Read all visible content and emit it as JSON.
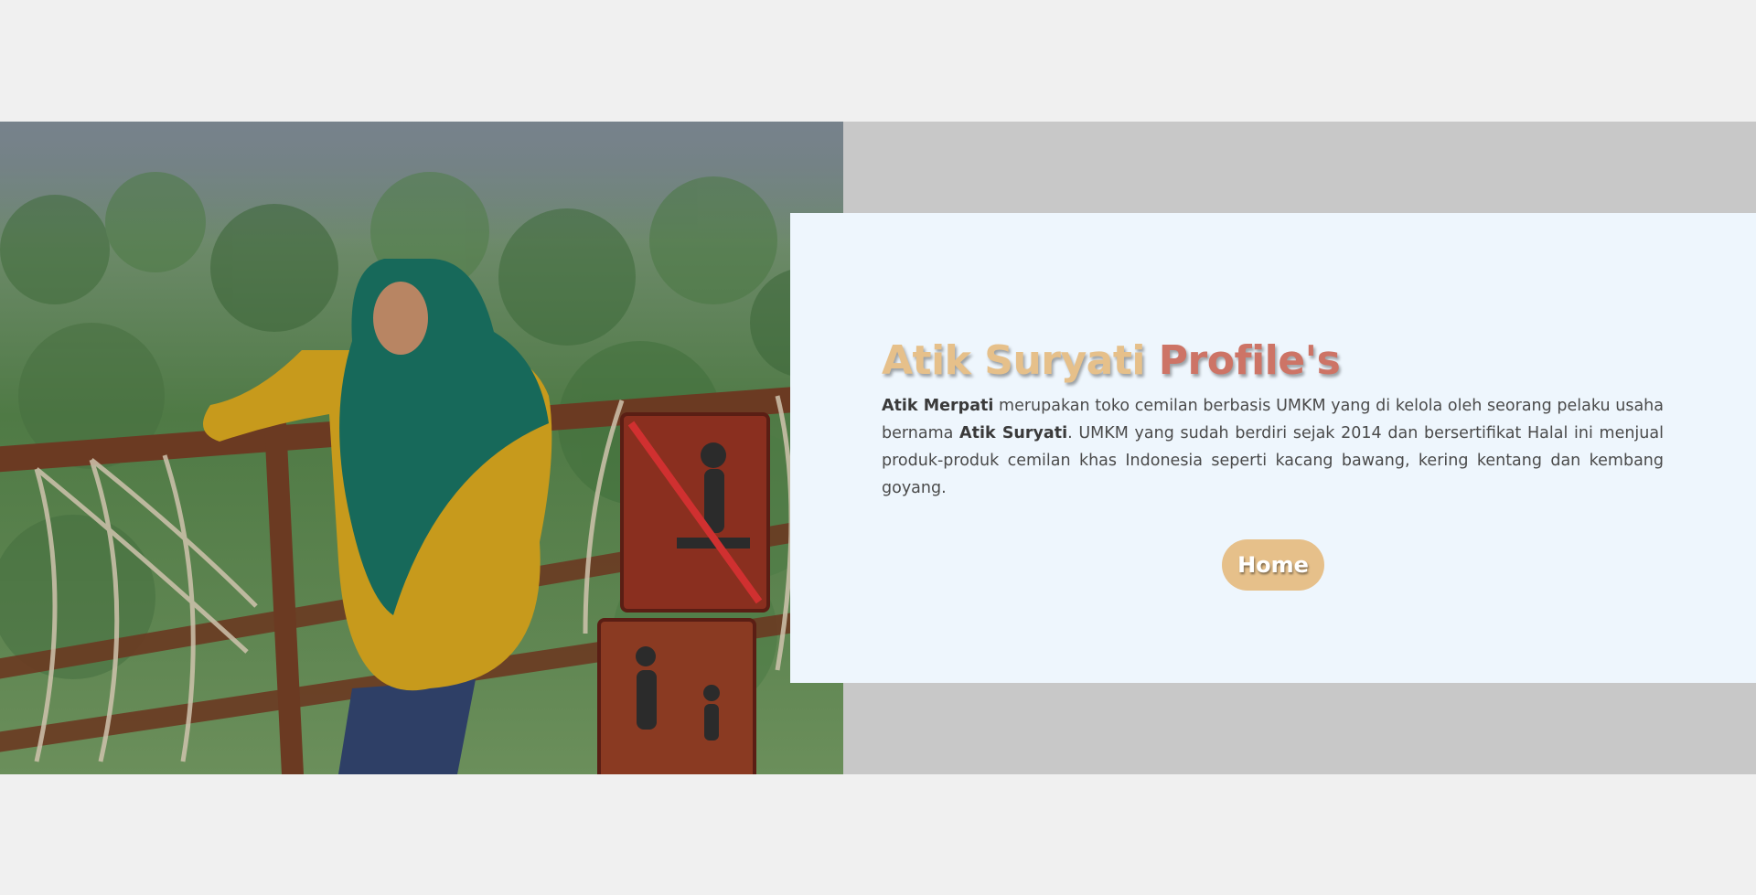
{
  "profile": {
    "title_name": "Atik Suryati",
    "title_suffix": "Profile's",
    "description": {
      "shop_name": "Atik Merpati",
      "text_1": " merupakan toko cemilan berbasis UMKM yang di kelola oleh seorang pelaku usaha bernama ",
      "owner_name": "Atik Suryati",
      "text_2": ". UMKM yang sudah berdiri sejak 2014 dan bersertifikat Halal ini menjual produk-produk cemilan khas Indonesia seperti kacang bawang, kering kentang dan kembang goyang."
    },
    "home_button": "Home"
  },
  "colors": {
    "page_background": "#f0f0f0",
    "band": "#c8c8c8",
    "card_background": "#eef6fd",
    "accent_gold": "#e6c08a",
    "accent_red": "#cd7466",
    "body_text": "#4a4a4a"
  },
  "icons": {
    "no_sitting_sign": "no-sitting-sign-icon",
    "parent_child_sign": "parent-child-sign-icon"
  }
}
